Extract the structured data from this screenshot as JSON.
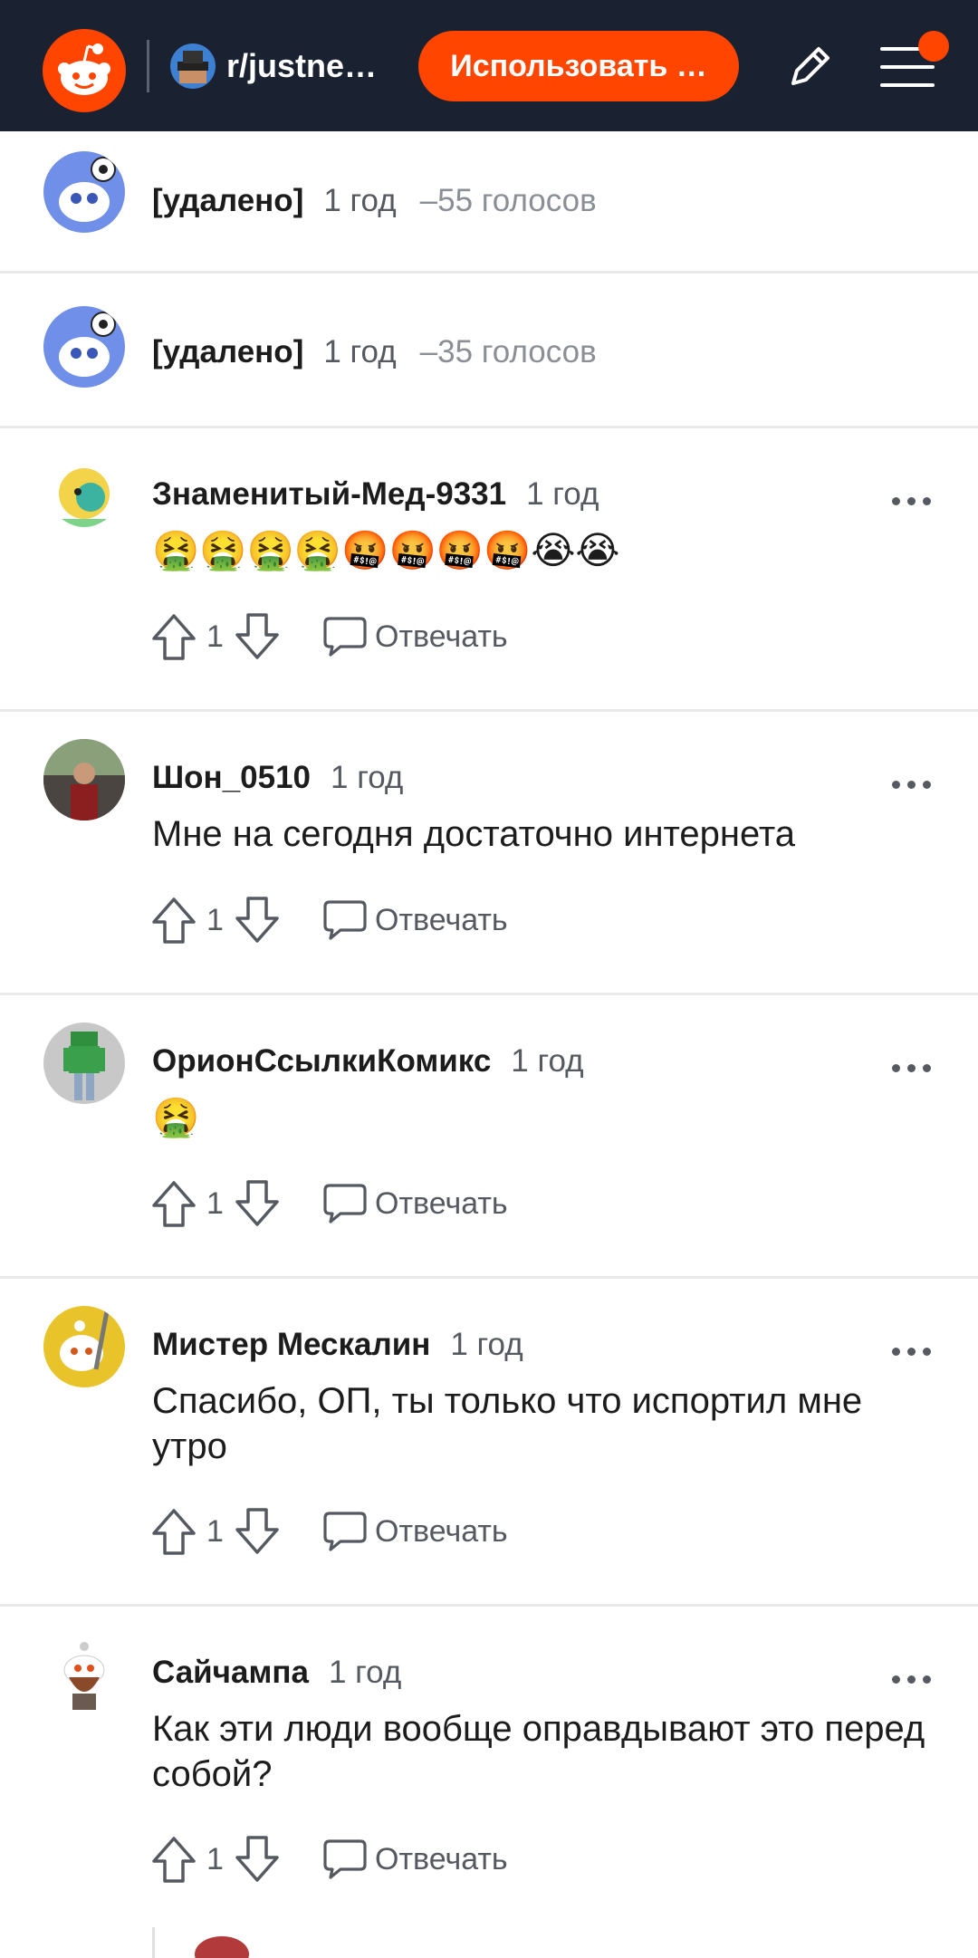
{
  "header": {
    "subreddit": "r/justne…",
    "use_app_label": "Использовать …",
    "colors": {
      "bar": "#1a2130",
      "accent": "#ff4500"
    },
    "icons": [
      "reddit-logo-icon",
      "pencil-icon",
      "menu-icon"
    ]
  },
  "comments": [
    {
      "author": "[удалено]",
      "time": "1 год",
      "votes": "–55 голосов"
    },
    {
      "author": "[удалено]",
      "time": "1 год",
      "votes": "–35 голосов"
    },
    {
      "author": "Знаменитый-Мед-9331",
      "time": "1 год",
      "text": "🤮🤮🤮🤮🤬🤬🤬🤬😭😭",
      "score": "1",
      "reply": "Отвечать"
    },
    {
      "author": "Шон_0510",
      "time": "1 год",
      "text": "Мне на сегодня достаточно интернета",
      "score": "1",
      "reply": "Отвечать"
    },
    {
      "author": "ОрионСсылкиКомикс",
      "time": "1 год",
      "text": "🤮",
      "score": "1",
      "reply": "Отвечать"
    },
    {
      "author": "Мистер Мескалин",
      "time": "1 год",
      "text": "Спасибо, ОП, ты только что испортил мне утро",
      "score": "1",
      "reply": "Отвечать"
    },
    {
      "author": "Сайчампа",
      "time": "1 год",
      "text": "Как эти люди вообще оправдывают это перед собой?",
      "score": "1",
      "reply": "Отвечать"
    }
  ]
}
